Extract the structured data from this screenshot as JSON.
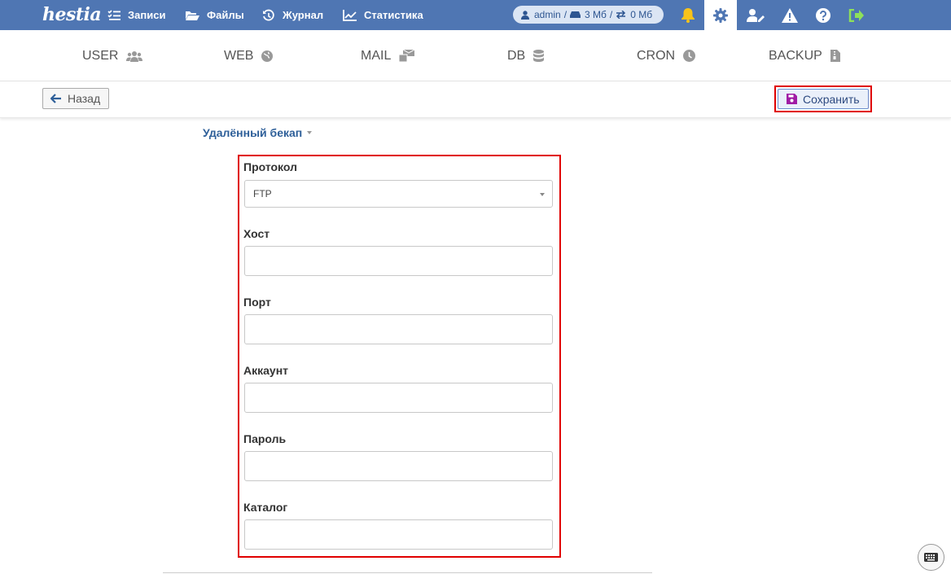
{
  "topbar": {
    "logo_text": "hestia",
    "nav": [
      {
        "label": "Записи",
        "icon": "list-check-icon"
      },
      {
        "label": "Файлы",
        "icon": "folder-open-icon"
      },
      {
        "label": "Журнал",
        "icon": "history-icon"
      },
      {
        "label": "Статистика",
        "icon": "chart-line-icon"
      }
    ],
    "stats": {
      "user": "admin",
      "disk": "3 Мб",
      "separator": "/",
      "bandwidth": "0 Мб"
    },
    "icons": [
      "bell-icon",
      "gear-icon",
      "user-edit-icon",
      "warning-icon",
      "help-icon",
      "logout-icon"
    ],
    "colors": {
      "bar": "#4f76b3",
      "bell": "#f8c31a",
      "logout": "#8ee05a"
    }
  },
  "tabs": [
    {
      "label": "USER",
      "icon": "users-icon"
    },
    {
      "label": "WEB",
      "icon": "globe-icon"
    },
    {
      "label": "MAIL",
      "icon": "mail-bulk-icon"
    },
    {
      "label": "DB",
      "icon": "database-icon"
    },
    {
      "label": "CRON",
      "icon": "clock-icon"
    },
    {
      "label": "BACKUP",
      "icon": "file-archive-icon"
    }
  ],
  "toolbar": {
    "back_label": "Назад",
    "save_label": "Сохранить"
  },
  "section": {
    "title": "Удалённый бекап"
  },
  "form": {
    "protocol_label": "Протокол",
    "protocol_value": "FTP",
    "fields": [
      {
        "label": "Хост",
        "value": ""
      },
      {
        "label": "Порт",
        "value": ""
      },
      {
        "label": "Аккаунт",
        "value": ""
      },
      {
        "label": "Пароль",
        "value": ""
      },
      {
        "label": "Каталог",
        "value": ""
      }
    ]
  }
}
